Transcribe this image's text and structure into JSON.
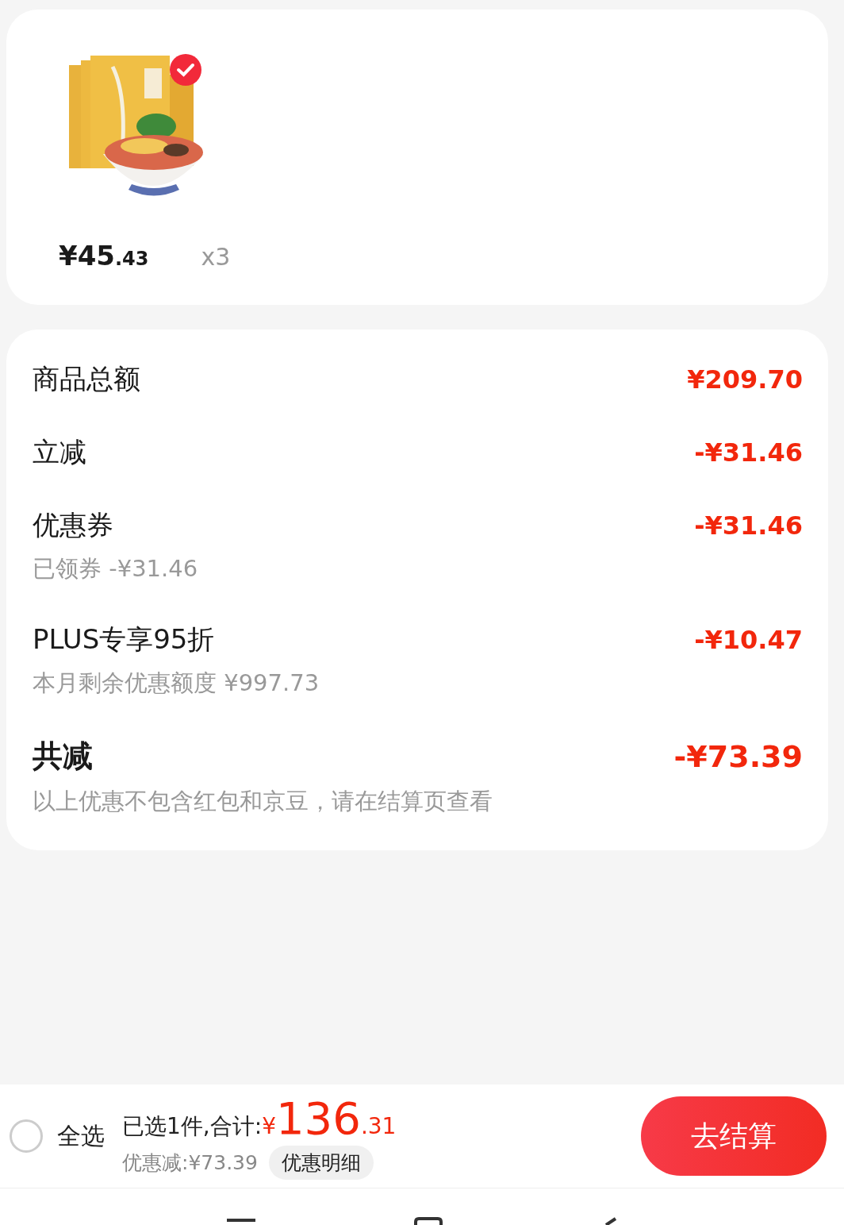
{
  "product": {
    "selected": true,
    "price_main": "¥45",
    "price_decimal": ".43",
    "quantity": "x3"
  },
  "summary": {
    "rows": [
      {
        "kind": "line",
        "label": "商品总额",
        "amount": "¥209.70"
      },
      {
        "kind": "line",
        "label": "立减",
        "amount": "-¥31.46"
      },
      {
        "kind": "line",
        "label": "优惠券",
        "amount": "-¥31.46",
        "note": "已领券 -¥31.46"
      },
      {
        "kind": "line",
        "label": "PLUS专享95折",
        "amount": "-¥10.47",
        "note": "本月剩余优惠额度 ¥997.73"
      },
      {
        "kind": "total",
        "label": "共减",
        "amount": "-¥73.39",
        "note": "以上优惠不包含红包和京豆，请在结算页查看"
      }
    ]
  },
  "footer": {
    "select_all": {
      "label": "全选",
      "checked": false
    },
    "selected_text": "已选1件,合计:",
    "currency": "¥",
    "total_main": "136",
    "total_decimal": ".31",
    "discount": "优惠减:¥73.39",
    "detail_button": "优惠明细",
    "checkout_button": "去结算"
  }
}
